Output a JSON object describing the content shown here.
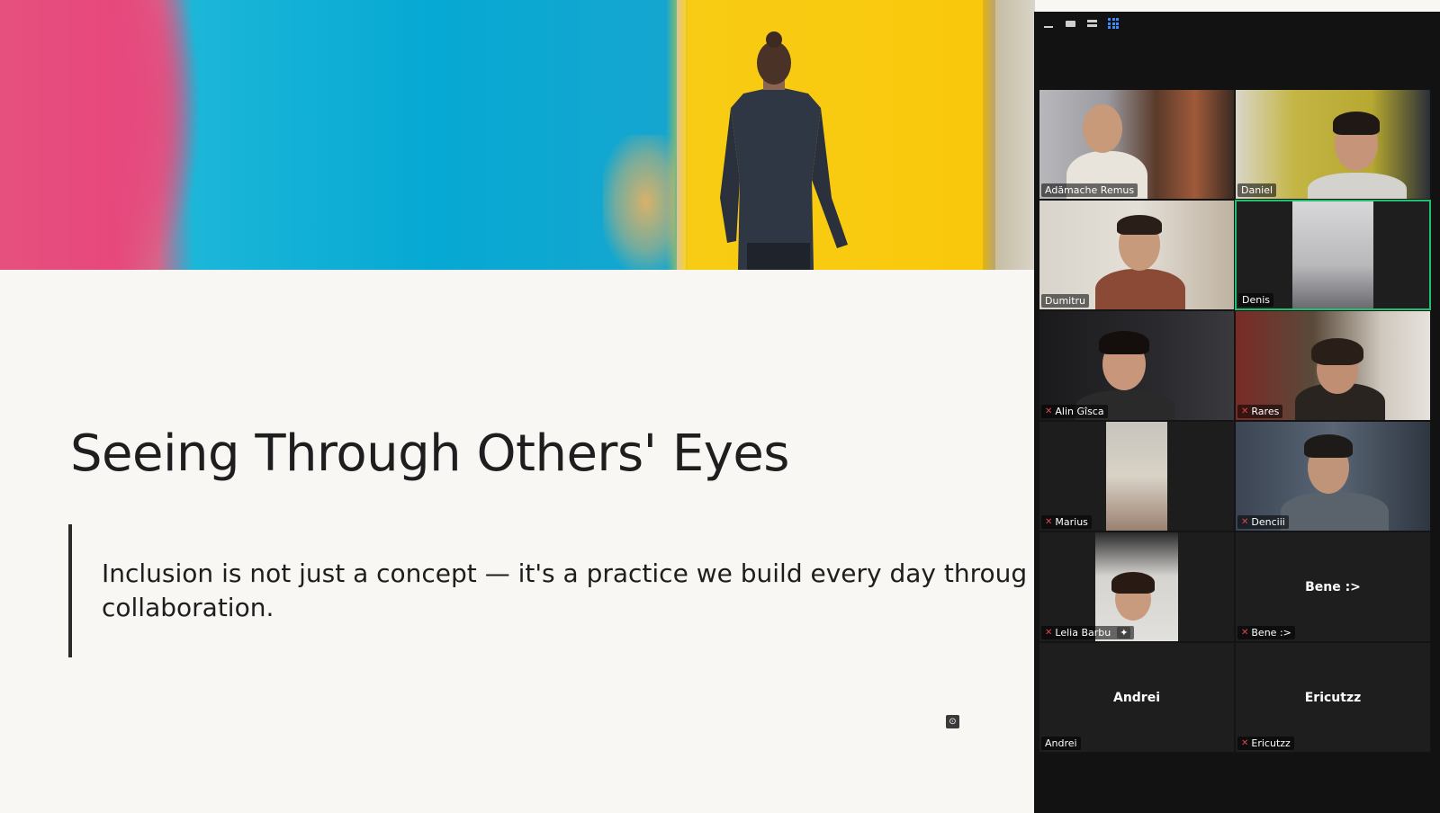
{
  "slide": {
    "title": "Seeing Through Others' Eyes",
    "quote_line1": "Inclusion is not just a concept — it's a practice we build every day through",
    "quote_line2": "collaboration."
  },
  "panel": {
    "view_buttons": [
      "minimize-icon",
      "speaker-view-icon",
      "strip-view-icon",
      "gallery-view-icon"
    ],
    "participants": [
      {
        "name": "Adămache Remus",
        "muted": false,
        "video": true
      },
      {
        "name": "Daniel",
        "muted": false,
        "video": true
      },
      {
        "name": "Dumitru",
        "muted": false,
        "video": true
      },
      {
        "name": "Denis",
        "muted": false,
        "video": true,
        "active": true
      },
      {
        "name": "Alin Gîsca",
        "muted": true,
        "video": true
      },
      {
        "name": "Rares",
        "muted": true,
        "video": true
      },
      {
        "name": "Marius",
        "muted": true,
        "video": true
      },
      {
        "name": "Denciii",
        "muted": true,
        "video": true
      },
      {
        "name": "Lelia Barbu",
        "muted": true,
        "video": true
      },
      {
        "name": "Bene :>",
        "muted": true,
        "video": false
      },
      {
        "name": "Andrei",
        "muted": false,
        "video": false
      },
      {
        "name": "Ericutzz",
        "muted": true,
        "video": false
      }
    ]
  },
  "colors": {
    "accent_active_border": "#20c070",
    "mute_red": "#e0464e",
    "gallery_icon_blue": "#3b8cff"
  }
}
